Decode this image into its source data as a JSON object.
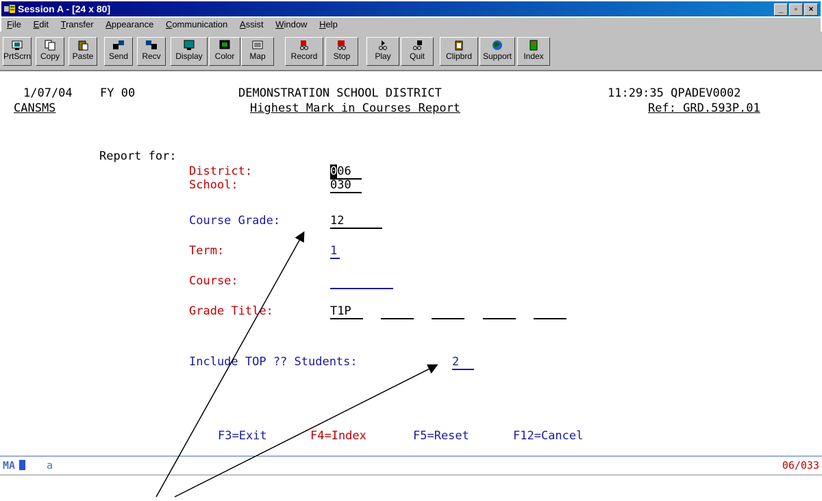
{
  "window": {
    "title": "Session A - [24 x 80]",
    "controls": [
      "_",
      "▫",
      "×"
    ]
  },
  "menu": [
    "File",
    "Edit",
    "Transfer",
    "Appearance",
    "Communication",
    "Assist",
    "Window",
    "Help"
  ],
  "toolbar": [
    {
      "label": "PrtScrn",
      "icon": "printer-screen-icon",
      "color": "#006b6b"
    },
    {
      "label": "Copy",
      "icon": "copy-icon",
      "color": "#000000"
    },
    {
      "label": "Paste",
      "icon": "paste-icon",
      "color": "#8b6b00"
    },
    {
      "label": "Send",
      "icon": "send-icon",
      "color": "#004080"
    },
    {
      "label": "Recv",
      "icon": "receive-icon",
      "color": "#004080"
    },
    {
      "label": "Display",
      "icon": "display-icon",
      "color": "#008080"
    },
    {
      "label": "Color",
      "icon": "color-icon",
      "color": "#000000"
    },
    {
      "label": "Map",
      "icon": "map-icon",
      "color": "#404040"
    },
    {
      "label": "Record",
      "icon": "record-icon",
      "color": "#cc0000"
    },
    {
      "label": "Stop",
      "icon": "stop-icon",
      "color": "#cc0000"
    },
    {
      "label": "Play",
      "icon": "play-icon",
      "color": "#000000"
    },
    {
      "label": "Quit",
      "icon": "quit-icon",
      "color": "#000000"
    },
    {
      "label": "Clipbrd",
      "icon": "clipboard-icon",
      "color": "#8b6b00"
    },
    {
      "label": "Support",
      "icon": "support-icon",
      "color": "#006600"
    },
    {
      "label": "Index",
      "icon": "index-icon",
      "color": "#806000"
    }
  ],
  "header": {
    "date": "1/07/04",
    "fy": "FY 00",
    "district_title": "DEMONSTRATION SCHOOL DISTRICT",
    "time_user": "11:29:35 QPADEV0002",
    "program": "CANSMS",
    "report_title": "Highest Mark in Courses Report",
    "ref": "Ref: GRD.593P.01"
  },
  "form": {
    "report_for": "Report for:",
    "district_label": "District:",
    "district_value_first": "0",
    "district_value_rest": "06",
    "school_label": "School:",
    "school_value": "030",
    "course_grade_label": "Course Grade:",
    "course_grade_value": "12",
    "term_label": "Term:",
    "term_value": "1",
    "course_label": "Course:",
    "course_value": "",
    "grade_title_label": "Grade Title:",
    "grade_title_values": [
      "T1P",
      "",
      "",
      "",
      ""
    ],
    "include_top_label": "Include TOP ?? Students:",
    "include_top_value": "2"
  },
  "function_keys": {
    "f3": "F3=Exit",
    "f4": "F4=Index",
    "f5": "F5=Reset",
    "f12": "F12=Cancel"
  },
  "status": {
    "indicator": "MA",
    "mode_char": "a",
    "cursor_position": "06/033"
  }
}
